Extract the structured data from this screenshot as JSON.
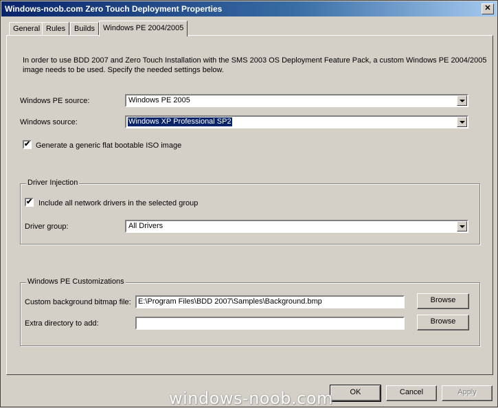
{
  "window": {
    "title": "Windows-noob.com Zero Touch Deployment Properties",
    "close_glyph": "✕"
  },
  "tabs": [
    {
      "label": "General"
    },
    {
      "label": "Rules"
    },
    {
      "label": "Builds"
    },
    {
      "label": "Windows PE 2004/2005",
      "active": true
    }
  ],
  "panel": {
    "intro": "In order to use BDD 2007 and Zero Touch Installation with the SMS 2003 OS Deployment Feature Pack, a custom Windows PE 2004/2005 image needs to be used.  Specify the needed settings below.",
    "pe_source": {
      "label": "Windows PE source:",
      "value": "Windows PE 2005"
    },
    "win_source": {
      "label": "Windows source:",
      "value": "Windows XP Professional SP2"
    },
    "iso": {
      "label": "Generate a generic flat bootable ISO image",
      "checked": true,
      "mark": "✔"
    },
    "driver_injection": {
      "title": "Driver Injection",
      "include": {
        "label": "Include all network drivers in the selected group",
        "checked": true,
        "mark": "✔"
      },
      "group": {
        "label": "Driver group:",
        "value": "All Drivers"
      }
    },
    "customizations": {
      "title": "Windows PE Customizations",
      "bitmap": {
        "label": "Custom background bitmap file:",
        "value": "E:\\Program Files\\BDD 2007\\Samples\\Background.bmp",
        "browse": "Browse"
      },
      "extra_dir": {
        "label": "Extra directory to add:",
        "value": "",
        "browse": "Browse"
      }
    }
  },
  "buttons": {
    "ok": "OK",
    "cancel": "Cancel",
    "apply": "Apply"
  },
  "watermark": "windows-noob.com"
}
